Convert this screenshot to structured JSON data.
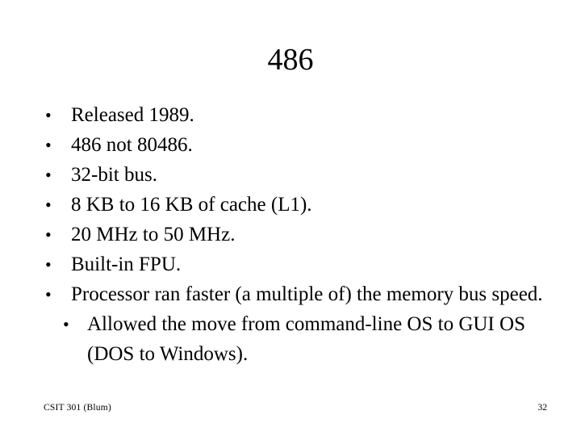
{
  "slide": {
    "title": "486",
    "bullet_marker": "•",
    "bullets": [
      {
        "text": "Released 1989.",
        "indent": 0
      },
      {
        "text": "486 not 80486.",
        "indent": 0
      },
      {
        "text": "32-bit bus.",
        "indent": 0
      },
      {
        "text": "8 KB to 16 KB of cache (L1).",
        "indent": 0
      },
      {
        "text": "20 MHz to 50 MHz.",
        "indent": 0
      },
      {
        "text": "Built-in FPU.",
        "indent": 0
      },
      {
        "text": "Processor ran faster (a multiple of) the memory bus speed.",
        "indent": 0
      },
      {
        "text": "Allowed the move from command-line OS to GUI OS (DOS to Windows).",
        "indent": 1
      }
    ],
    "footer_left": "CSIT 301 (Blum)",
    "footer_right": "32"
  }
}
